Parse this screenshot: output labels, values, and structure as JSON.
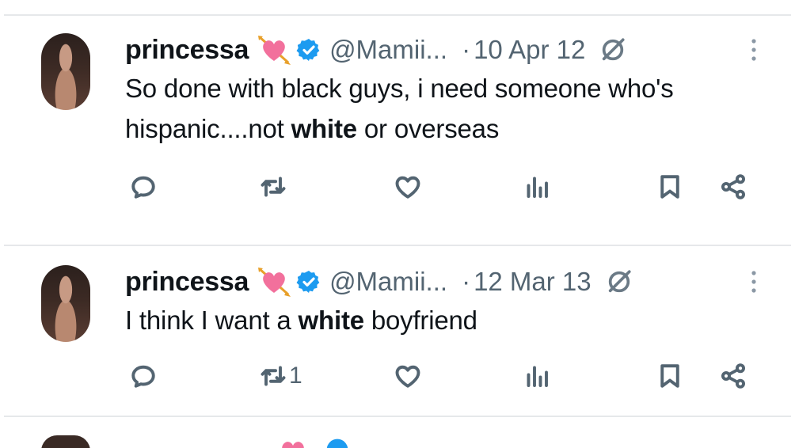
{
  "colors": {
    "text": "#0f1419",
    "secondary": "#536471",
    "verified": "#1d9bf0",
    "heart_emoji": "#f2709c"
  },
  "tweets": [
    {
      "name": "princessa",
      "handle": "@Mamii...",
      "separator": "·",
      "date": "10 Apr 12",
      "text_before": "So done with black guys, i need someone who's hispanic....not ",
      "text_bold": "white",
      "text_after": " or overseas",
      "reposts_count": ""
    },
    {
      "name": "princessa",
      "handle": "@Mamii...",
      "separator": "·",
      "date": "12 Mar 13",
      "text_before": "I think I want a ",
      "text_bold": "white",
      "text_after": " boyfriend",
      "reposts_count": "1"
    }
  ],
  "icons": {
    "avatar": "profile-photo",
    "heart_emoji": "heart-with-arrow-emoji",
    "verified": "verified-badge",
    "grok": "grok-icon",
    "more": "more-vertical-icon",
    "reply": "reply-icon",
    "repost": "repost-icon",
    "like": "like-icon",
    "views": "views-icon",
    "bookmark": "bookmark-icon",
    "share": "share-icon"
  }
}
